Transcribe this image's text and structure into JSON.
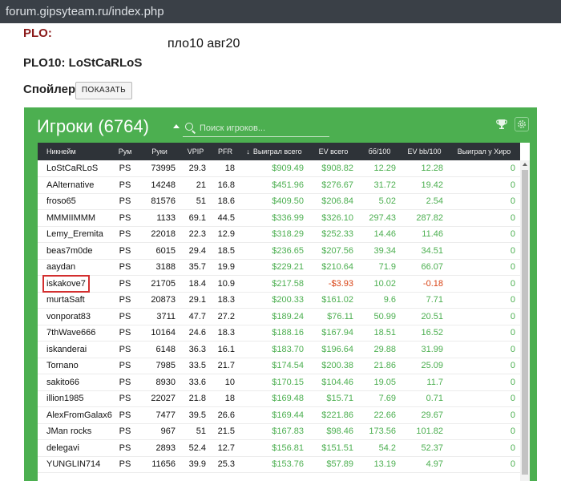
{
  "browser": {
    "url": "forum.gipsyteam.ru/index.php"
  },
  "post": {
    "plo_label": "PLO:",
    "plo_date": "пло10 авг20",
    "plo10_line": "PLO10: LoStCaRLoS",
    "spoiler_label": "Спойлер:",
    "spoiler_button": "ПОКАЗАТЬ"
  },
  "widget": {
    "title": "Игроки (6764)",
    "search_placeholder": "Поиск игроков...",
    "icons": [
      "trophy-icon",
      "gear-icon",
      "search-icon",
      "caret-up-icon"
    ],
    "accent_color": "#4caf50",
    "header_color": "#2e3338",
    "columns": [
      "Никнейм",
      "Рум",
      "Руки",
      "VPIP",
      "PFR",
      "Выиграл всего",
      "EV всего",
      "бб/100",
      "EV bb/100",
      "Выиграл у Хиро"
    ],
    "rows": [
      {
        "name": "LoStCaRLoS",
        "room": "PS",
        "hands": "73995",
        "vpip": "29.3",
        "pfr": "18",
        "won": "$909.49",
        "ev": "$908.82",
        "bb": "12.29",
        "evbb": "12.28",
        "hero": "0"
      },
      {
        "name": "AAlternative",
        "room": "PS",
        "hands": "14248",
        "vpip": "21",
        "pfr": "16.8",
        "won": "$451.96",
        "ev": "$276.67",
        "bb": "31.72",
        "evbb": "19.42",
        "hero": "0"
      },
      {
        "name": "froso65",
        "room": "PS",
        "hands": "81576",
        "vpip": "51",
        "pfr": "18.6",
        "won": "$409.50",
        "ev": "$206.84",
        "bb": "5.02",
        "evbb": "2.54",
        "hero": "0"
      },
      {
        "name": "MMMIIMMM",
        "room": "PS",
        "hands": "1133",
        "vpip": "69.1",
        "pfr": "44.5",
        "won": "$336.99",
        "ev": "$326.10",
        "bb": "297.43",
        "evbb": "287.82",
        "hero": "0"
      },
      {
        "name": "Lemy_Eremita",
        "room": "PS",
        "hands": "22018",
        "vpip": "22.3",
        "pfr": "12.9",
        "won": "$318.29",
        "ev": "$252.33",
        "bb": "14.46",
        "evbb": "11.46",
        "hero": "0"
      },
      {
        "name": "beas7m0de",
        "room": "PS",
        "hands": "6015",
        "vpip": "29.4",
        "pfr": "18.5",
        "won": "$236.65",
        "ev": "$207.56",
        "bb": "39.34",
        "evbb": "34.51",
        "hero": "0"
      },
      {
        "name": "aaydan",
        "room": "PS",
        "hands": "3188",
        "vpip": "35.7",
        "pfr": "19.9",
        "won": "$229.21",
        "ev": "$210.64",
        "bb": "71.9",
        "evbb": "66.07",
        "hero": "0"
      },
      {
        "name": "iskakove7",
        "room": "PS",
        "hands": "21705",
        "vpip": "18.4",
        "pfr": "10.9",
        "won": "$217.58",
        "ev": "-$3.93",
        "bb": "10.02",
        "evbb": "-0.18",
        "hero": "0"
      },
      {
        "name": "murtaSaft",
        "room": "PS",
        "hands": "20873",
        "vpip": "29.1",
        "pfr": "18.3",
        "won": "$200.33",
        "ev": "$161.02",
        "bb": "9.6",
        "evbb": "7.71",
        "hero": "0"
      },
      {
        "name": "vonporat83",
        "room": "PS",
        "hands": "3711",
        "vpip": "47.7",
        "pfr": "27.2",
        "won": "$189.24",
        "ev": "$76.11",
        "bb": "50.99",
        "evbb": "20.51",
        "hero": "0"
      },
      {
        "name": "7thWave666",
        "room": "PS",
        "hands": "10164",
        "vpip": "24.6",
        "pfr": "18.3",
        "won": "$188.16",
        "ev": "$167.94",
        "bb": "18.51",
        "evbb": "16.52",
        "hero": "0"
      },
      {
        "name": "iskanderai",
        "room": "PS",
        "hands": "6148",
        "vpip": "36.3",
        "pfr": "16.1",
        "won": "$183.70",
        "ev": "$196.64",
        "bb": "29.88",
        "evbb": "31.99",
        "hero": "0"
      },
      {
        "name": "Tornano",
        "room": "PS",
        "hands": "7985",
        "vpip": "33.5",
        "pfr": "21.7",
        "won": "$174.54",
        "ev": "$200.38",
        "bb": "21.86",
        "evbb": "25.09",
        "hero": "0"
      },
      {
        "name": "sakito66",
        "room": "PS",
        "hands": "8930",
        "vpip": "33.6",
        "pfr": "10",
        "won": "$170.15",
        "ev": "$104.46",
        "bb": "19.05",
        "evbb": "11.7",
        "hero": "0"
      },
      {
        "name": "illion1985",
        "room": "PS",
        "hands": "22027",
        "vpip": "21.8",
        "pfr": "18",
        "won": "$169.48",
        "ev": "$15.71",
        "bb": "7.69",
        "evbb": "0.71",
        "hero": "0"
      },
      {
        "name": "AlexFromGalax6",
        "room": "PS",
        "hands": "7477",
        "vpip": "39.5",
        "pfr": "26.6",
        "won": "$169.44",
        "ev": "$221.86",
        "bb": "22.66",
        "evbb": "29.67",
        "hero": "0"
      },
      {
        "name": "JMan rocks",
        "room": "PS",
        "hands": "967",
        "vpip": "51",
        "pfr": "21.5",
        "won": "$167.83",
        "ev": "$98.46",
        "bb": "173.56",
        "evbb": "101.82",
        "hero": "0"
      },
      {
        "name": "delegavi",
        "room": "PS",
        "hands": "2893",
        "vpip": "52.4",
        "pfr": "12.7",
        "won": "$156.81",
        "ev": "$151.51",
        "bb": "54.2",
        "evbb": "52.37",
        "hero": "0"
      },
      {
        "name": "YUNGLIN714",
        "room": "PS",
        "hands": "11656",
        "vpip": "39.9",
        "pfr": "25.3",
        "won": "$153.76",
        "ev": "$57.89",
        "bb": "13.19",
        "evbb": "4.97",
        "hero": "0"
      }
    ],
    "highlighted_row": 7
  }
}
